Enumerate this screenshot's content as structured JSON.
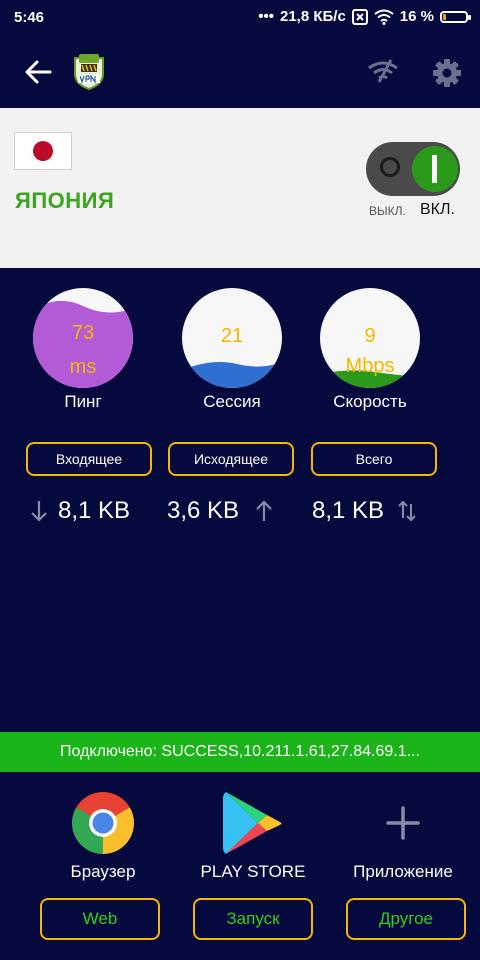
{
  "status_bar": {
    "time": "5:46",
    "dots": "•••",
    "network_speed": "21,8 КБ/с",
    "battery": "16 %"
  },
  "server": {
    "country": "ЯПОНИЯ",
    "switch_off_label": "ВЫКЛ.",
    "switch_on_label": "ВКЛ.",
    "connected": true
  },
  "stats": [
    {
      "value": "73",
      "unit": "ms",
      "label": "Пинг",
      "color": "#b35ad6"
    },
    {
      "value": "21",
      "unit": "",
      "label": "Сессия",
      "color": "#2f6fd0"
    },
    {
      "value": "9",
      "unit": "Mbps",
      "label": "Скорость",
      "color": "#2b9a1b"
    }
  ],
  "traffic": {
    "incoming_label": "Входящее",
    "outgoing_label": "Исходящее",
    "total_label": "Всего",
    "incoming": "8,1 KB",
    "outgoing": "3,6 KB",
    "total": "8,1 KB"
  },
  "status_message": "Подключено: SUCCESS,10.211.1.61,27.84.69.1...",
  "apps": [
    {
      "label": "Браузер",
      "button": "Web",
      "icon": "chrome-icon"
    },
    {
      "label": "PLAY STORE",
      "button": "Запуск",
      "icon": "play-store-icon"
    },
    {
      "label": "Приложение",
      "button": "Другое",
      "icon": "plus-icon"
    }
  ],
  "colors": {
    "background": "#05093d",
    "accent_green": "#1bb419",
    "accent_gold": "#f5b700",
    "country_green": "#3aa61d"
  }
}
